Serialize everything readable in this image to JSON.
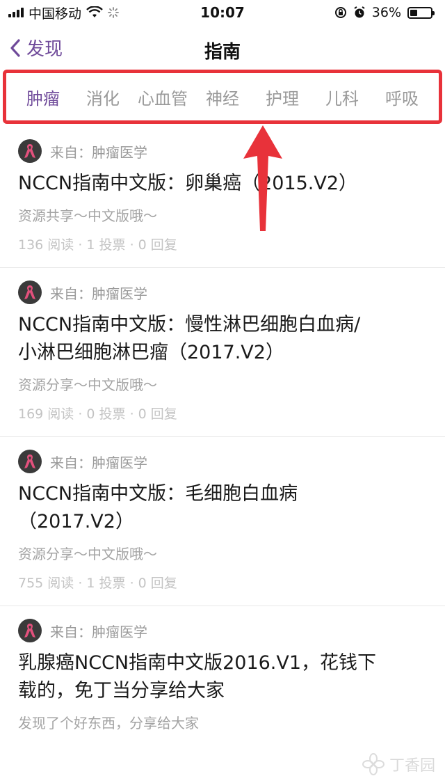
{
  "status_bar": {
    "carrier": "中国移动",
    "time": "10:07",
    "battery": "36%",
    "battery_level": 0.36
  },
  "nav": {
    "back_label": "发现",
    "title": "指南"
  },
  "tabs": [
    {
      "label": "肿瘤",
      "active": true
    },
    {
      "label": "消化",
      "active": false
    },
    {
      "label": "心血管",
      "active": false
    },
    {
      "label": "神经",
      "active": false
    },
    {
      "label": "护理",
      "active": false
    },
    {
      "label": "儿科",
      "active": false
    },
    {
      "label": "呼吸",
      "active": false
    }
  ],
  "cards": [
    {
      "source": "来自：肿瘤医学",
      "title_lines": [
        "NCCN指南中文版：卵巢癌（2015.V2）"
      ],
      "desc": "资源共享～中文版哦～",
      "stats": "136 阅读 · 1 投票 · 0 回复"
    },
    {
      "source": "来自：肿瘤医学",
      "title_lines": [
        "NCCN指南中文版：慢性淋巴细胞白血病/",
        "小淋巴细胞淋巴瘤（2017.V2）"
      ],
      "desc": "资源分享～中文版哦～",
      "stats": "169 阅读 · 0 投票 · 0 回复"
    },
    {
      "source": "来自：肿瘤医学",
      "title_lines": [
        "NCCN指南中文版：毛细胞白血病",
        "（2017.V2）"
      ],
      "desc": "资源分享～中文版哦～",
      "stats": "755 阅读 · 1 投票 · 0 回复"
    },
    {
      "source": "来自：肿瘤医学",
      "title_lines": [
        "乳腺癌NCCN指南中文版2016.V1，花钱下",
        "载的，免丁当分享给大家"
      ],
      "desc": "发现了个好东西，分享给大家",
      "stats": ""
    }
  ],
  "watermark": "丁香园",
  "colors": {
    "accent": "#6f4a9a",
    "highlight": "#e8323a",
    "ribbon": "#e2507c"
  },
  "icons": {
    "back": "chevron-left-icon",
    "avatar": "pink-ribbon-icon",
    "annotation": "red-arrow-up-icon"
  }
}
